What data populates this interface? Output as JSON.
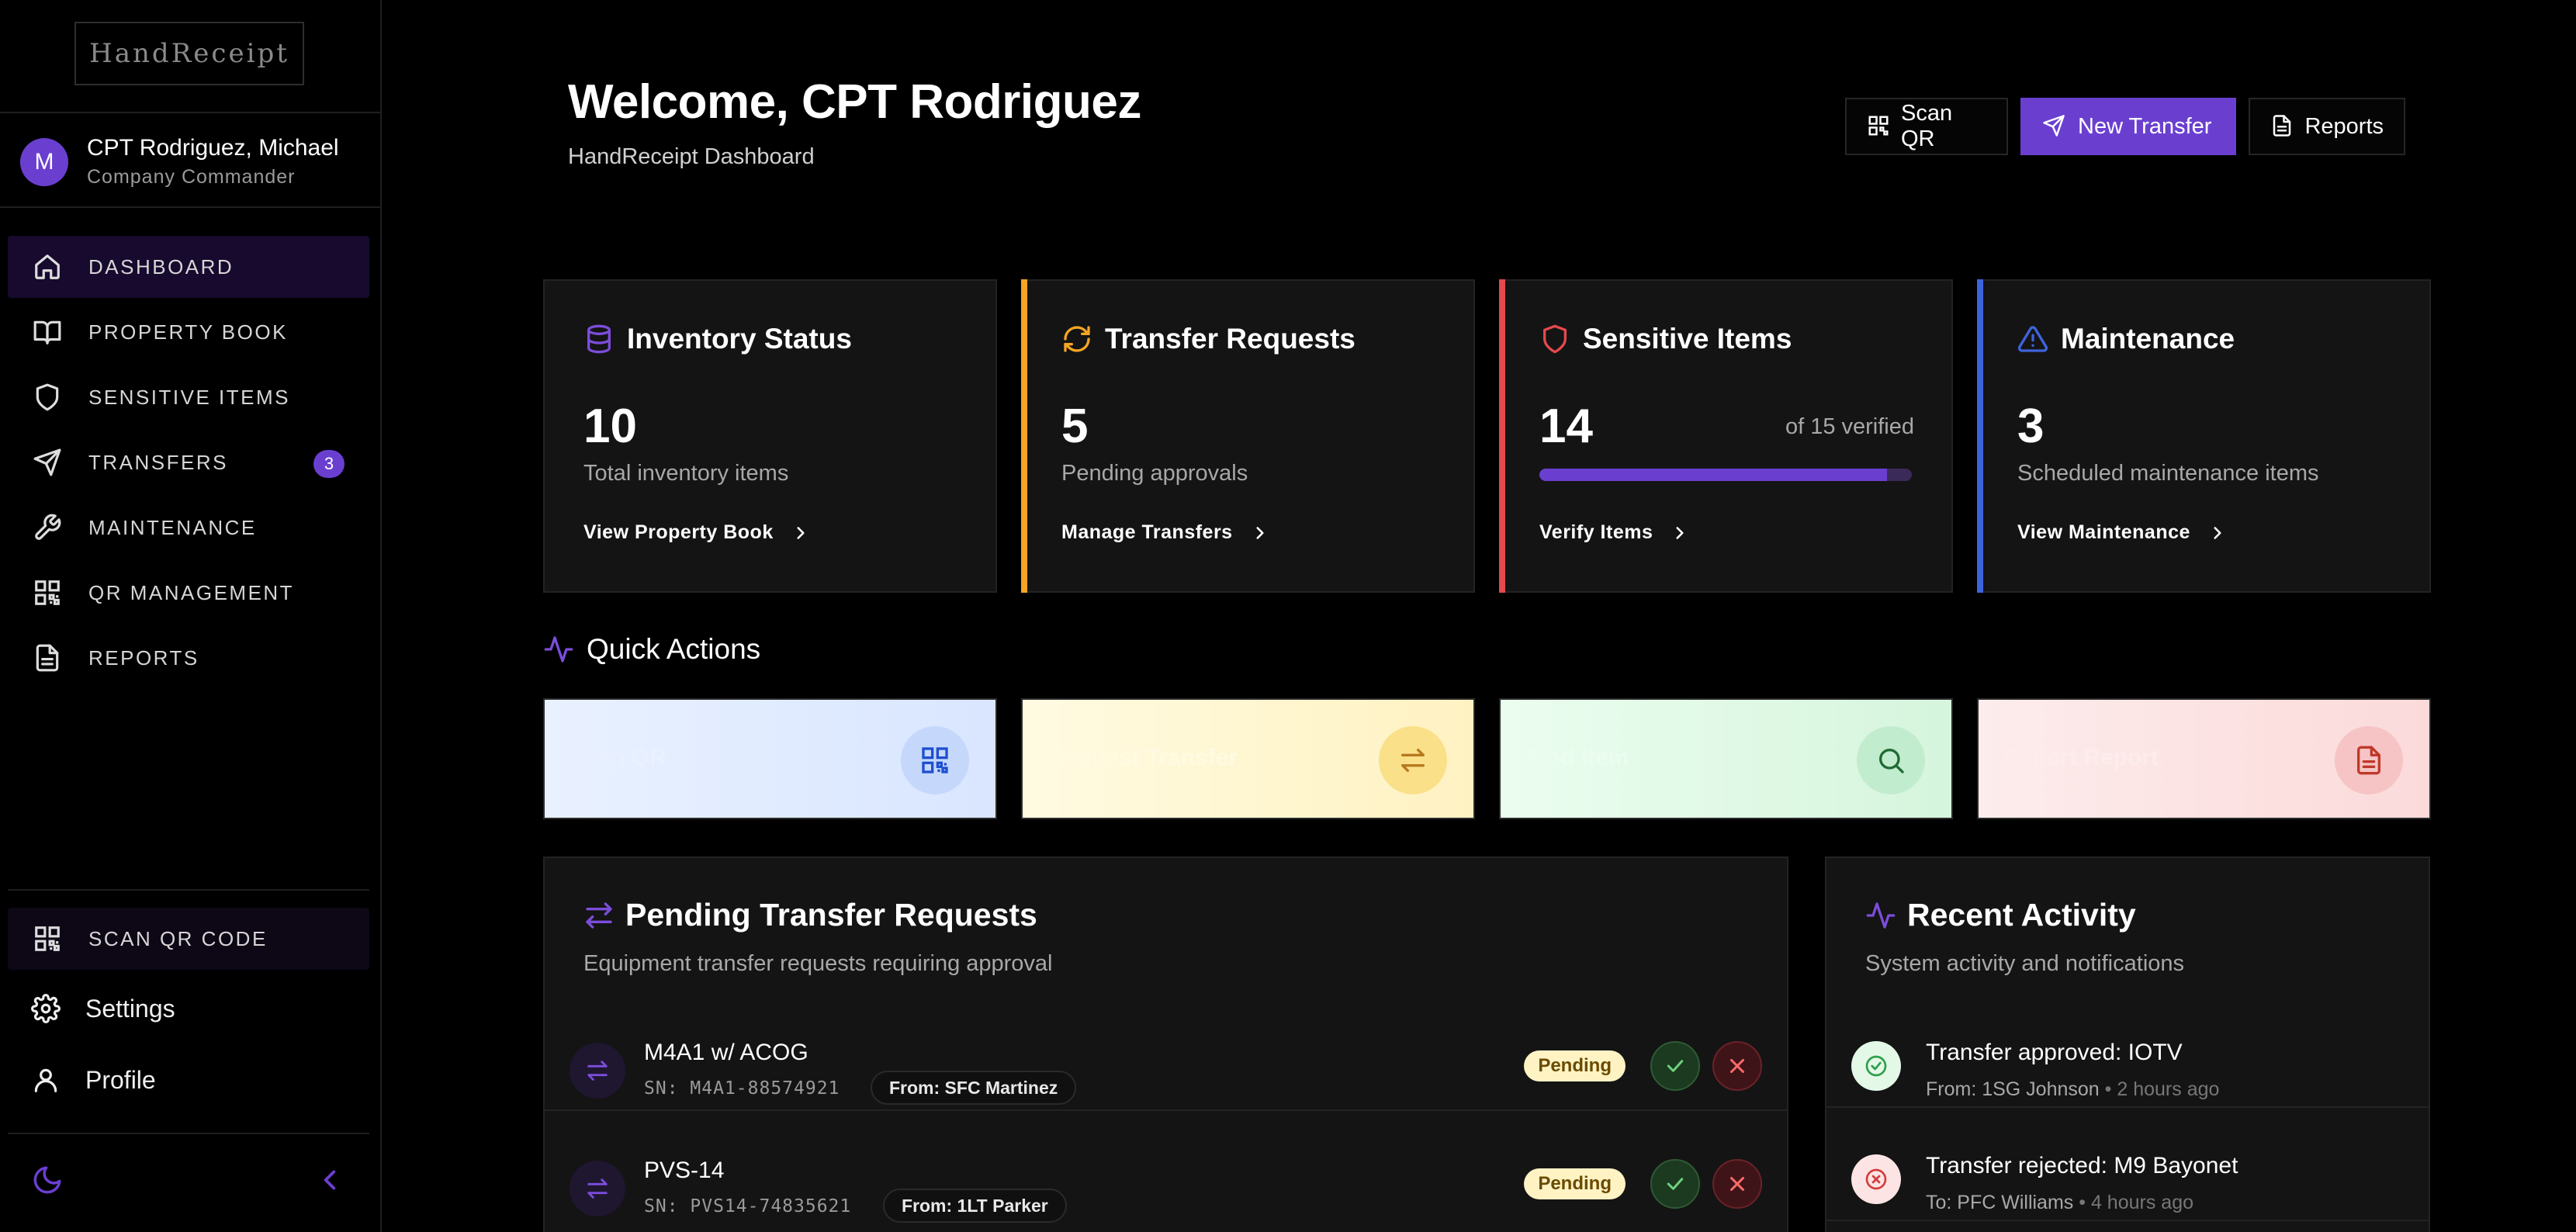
{
  "app": {
    "logo": "HandReceipt"
  },
  "user": {
    "initial": "M",
    "name": "CPT Rodriguez, Michael",
    "role": "Company Commander"
  },
  "nav": [
    {
      "label": "DASHBOARD",
      "icon": "home-icon",
      "active": true
    },
    {
      "label": "PROPERTY BOOK",
      "icon": "book-icon"
    },
    {
      "label": "SENSITIVE ITEMS",
      "icon": "shield-icon"
    },
    {
      "label": "TRANSFERS",
      "icon": "send-icon",
      "badge": "3"
    },
    {
      "label": "MAINTENANCE",
      "icon": "wrench-icon"
    },
    {
      "label": "QR MANAGEMENT",
      "icon": "qr-icon"
    },
    {
      "label": "REPORTS",
      "icon": "file-icon"
    }
  ],
  "sidebar_bottom": {
    "scan_qr_code": "SCAN QR CODE",
    "settings": "Settings",
    "profile": "Profile"
  },
  "header": {
    "title": "Welcome, CPT Rodriguez",
    "subtitle": "HandReceipt Dashboard",
    "buttons": {
      "scan_qr": "Scan QR",
      "new_transfer": "New Transfer",
      "reports": "Reports"
    }
  },
  "cards": {
    "inventory": {
      "title": "Inventory Status",
      "value": "10",
      "desc": "Total inventory items",
      "link": "View Property Book",
      "accent": "#6a3fd0"
    },
    "transfers": {
      "title": "Transfer Requests",
      "value": "5",
      "desc": "Pending approvals",
      "link": "Manage Transfers",
      "accent": "#f5a524"
    },
    "sensitive": {
      "title": "Sensitive Items",
      "value": "14",
      "aside": "of 15 verified",
      "progress": 0.933,
      "link": "Verify Items",
      "accent": "#e5484d"
    },
    "maintenance": {
      "title": "Maintenance",
      "value": "3",
      "desc": "Scheduled maintenance items",
      "link": "View Maintenance",
      "accent": "#3e63dd"
    }
  },
  "quick_actions": {
    "title": "Quick Actions",
    "items": [
      {
        "label": "Scan QR",
        "icon": "qr-icon",
        "bg": "#e6efff",
        "circle": "#c9dafc",
        "fg": "#1f4fd0"
      },
      {
        "label": "Request Transfer",
        "icon": "swap-icon",
        "bg": "#fff8d6",
        "circle": "#fbe39a",
        "fg": "#b7791f"
      },
      {
        "label": "Find Item",
        "icon": "search-icon",
        "bg": "#e5fbe9",
        "circle": "#c6efd0",
        "fg": "#1f6b35"
      },
      {
        "label": "Export Report",
        "icon": "file-icon",
        "bg": "#fde7e7",
        "circle": "#f8c9c9",
        "fg": "#c0392b"
      }
    ]
  },
  "pending": {
    "title": "Pending Transfer Requests",
    "subtitle": "Equipment transfer requests requiring approval",
    "rows": [
      {
        "name": "M4A1 w/ ACOG",
        "sn": "SN: M4A1-88574921",
        "from": "From: SFC Martinez",
        "status": "Pending"
      },
      {
        "name": "PVS-14",
        "sn": "SN: PVS14-74835621",
        "from": "From: 1LT Parker",
        "status": "Pending"
      }
    ]
  },
  "activity": {
    "title": "Recent Activity",
    "subtitle": "System activity and notifications",
    "items": [
      {
        "title": "Transfer approved: IOTV",
        "who": "From: 1SG Johnson",
        "time": "2 hours ago",
        "type": "approved"
      },
      {
        "title": "Transfer rejected: M9 Bayonet",
        "who": "To: PFC Williams",
        "time": "4 hours ago",
        "type": "rejected"
      }
    ]
  }
}
